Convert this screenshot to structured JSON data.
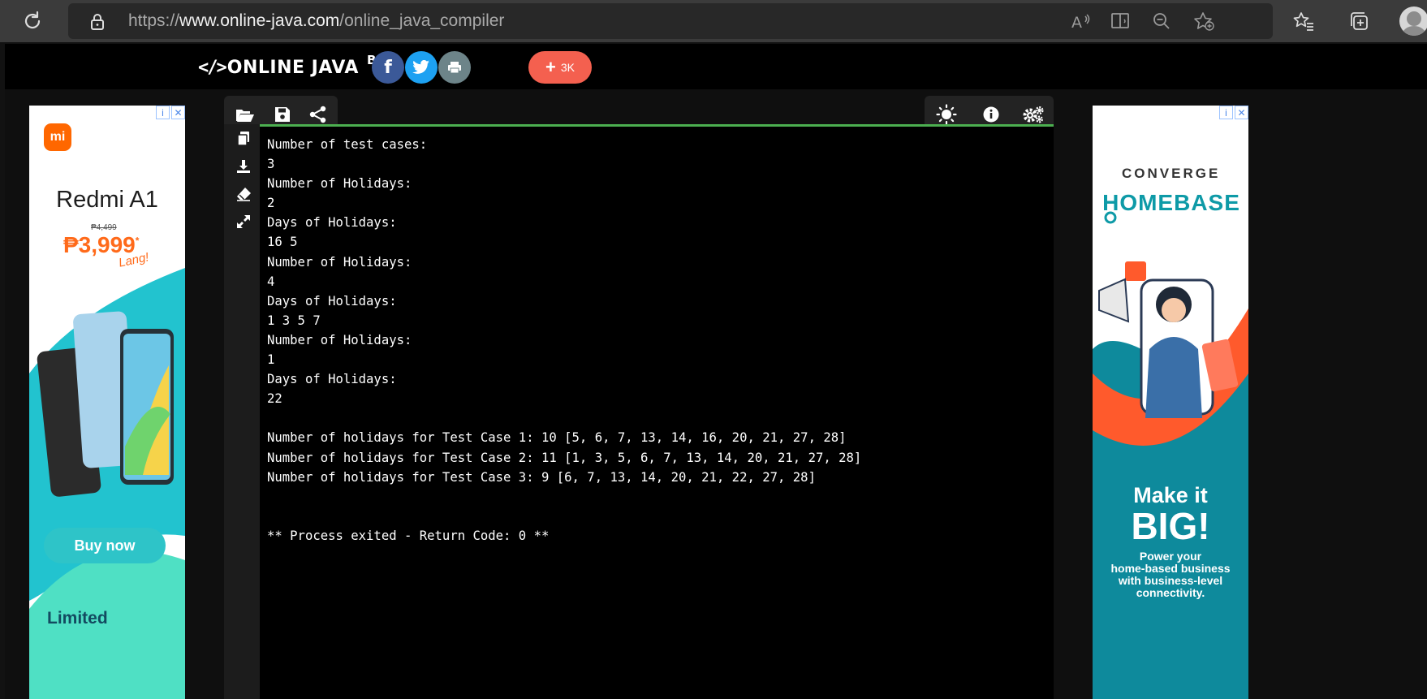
{
  "browser": {
    "url_prefix": "https://",
    "url_domain": "www.online-java.com",
    "url_path": "/online_java_compiler",
    "icons": [
      "reload-icon",
      "lock-icon",
      "read-aloud-icon",
      "immersive-reader-icon",
      "zoom-icon",
      "add-favorite-icon",
      "favorites-icon",
      "collections-icon",
      "profile-icon"
    ]
  },
  "brand": {
    "symbol": "</>",
    "name": "ONLINE JAVA",
    "beta": "BETA"
  },
  "share": {
    "facebook": "f",
    "plus_count": "3K"
  },
  "colors": {
    "accent_green": "#4caf50",
    "facebook": "#3b5998",
    "twitter": "#1da1f2",
    "print": "#6d8489",
    "plus": "#f4604f"
  },
  "toolbar_left": [
    "folder-open-icon",
    "save-icon",
    "share-icon"
  ],
  "toolbar_right": [
    "theme-icon",
    "info-icon",
    "settings-icon"
  ],
  "gutter": [
    "copy-icon",
    "download-icon",
    "eraser-icon",
    "expand-icon"
  ],
  "output": {
    "lines": [
      "Number of test cases:",
      "3",
      "Number of Holidays:",
      "2",
      "Days of Holidays:",
      "16 5",
      "Number of Holidays:",
      "4",
      "Days of Holidays:",
      "1 3 5 7",
      "Number of Holidays:",
      "1",
      "Days of Holidays:",
      "22",
      "",
      "Number of holidays for Test Case 1: 10 [5, 6, 7, 13, 14, 16, 20, 21, 27, 28]",
      "Number of holidays for Test Case 2: 11 [1, 3, 5, 6, 7, 13, 14, 20, 21, 27, 28]",
      "Number of holidays for Test Case 3: 9 [6, 7, 13, 14, 20, 21, 22, 27, 28]",
      "",
      "",
      "** Process exited - Return Code: 0 **"
    ]
  },
  "ad_left": {
    "brand": "mi",
    "product": "Redmi A1",
    "old_price": "₱4,499",
    "price": "₱3,999",
    "price_mark": "*",
    "tag": "Lang!",
    "cta": "Buy now",
    "footer": "Limited"
  },
  "ad_right": {
    "brand_top": "CONVERGE",
    "brand_bottom": "HOMEBASE",
    "headline_1": "Make it",
    "headline_2": "BIG!",
    "body_1": "Power your",
    "body_2": "home-based business",
    "body_3": "with business-level",
    "body_4": "connectivity."
  }
}
